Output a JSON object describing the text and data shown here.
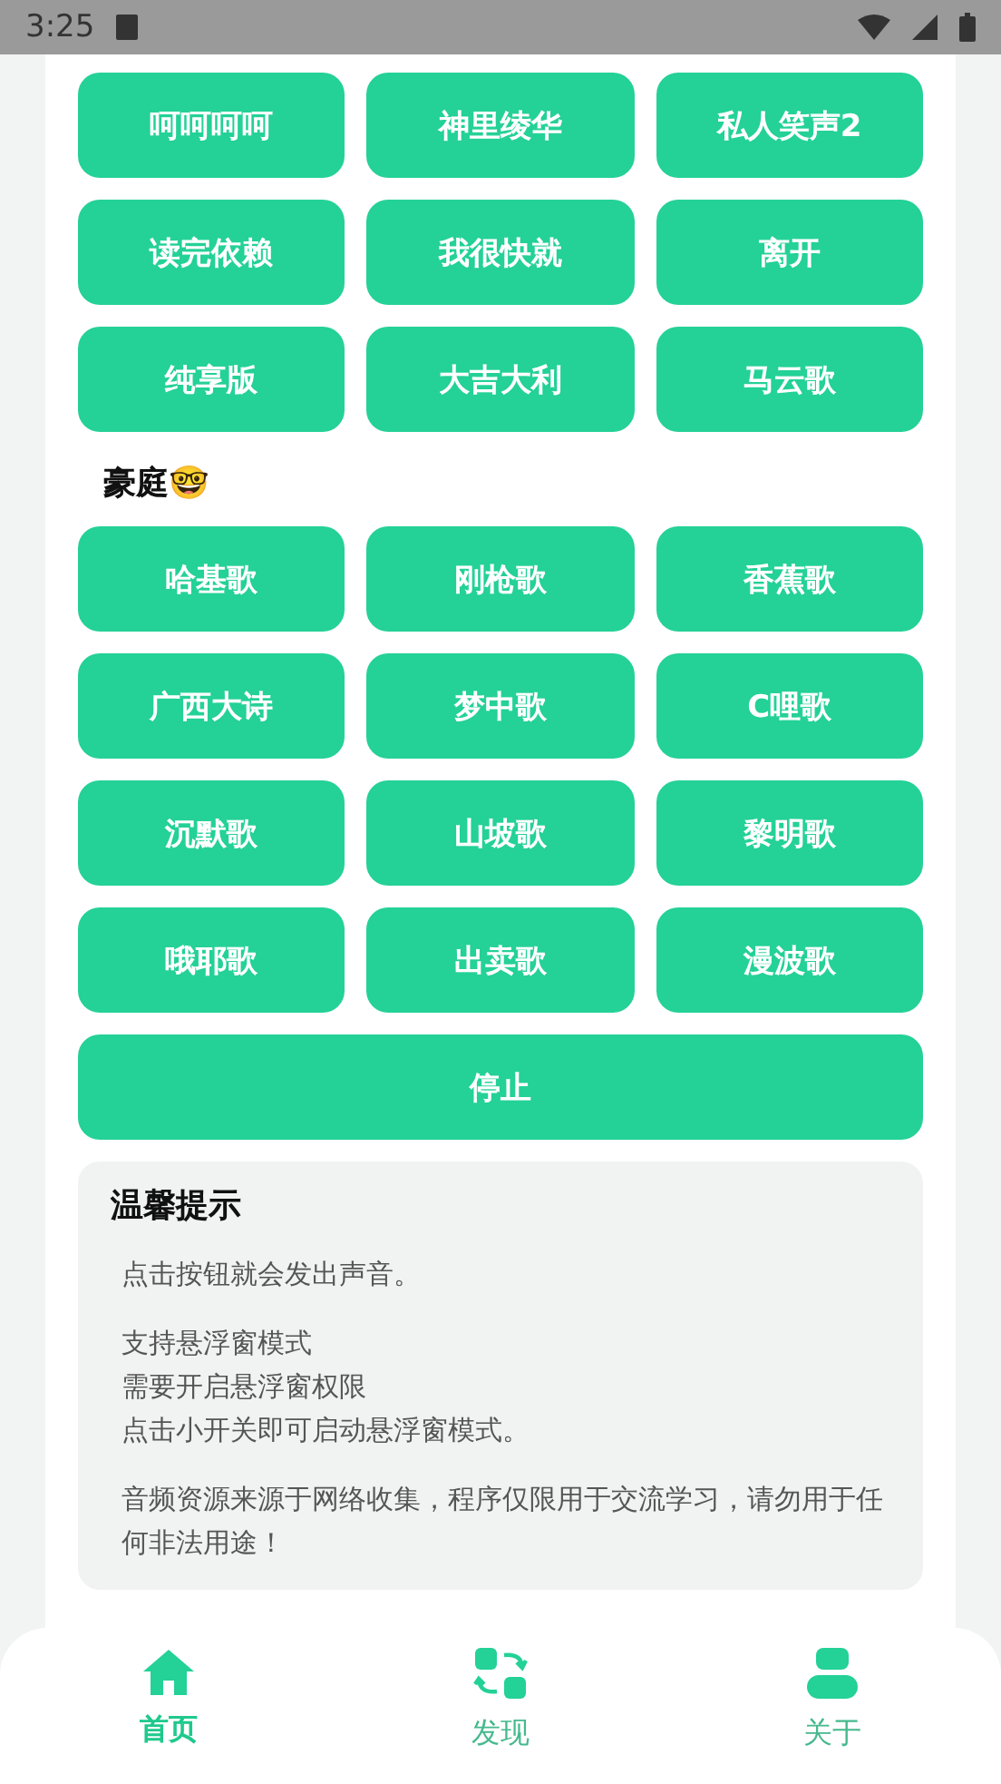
{
  "status_bar": {
    "time": "3:25"
  },
  "groups": [
    {
      "buttons": [
        "呵呵呵呵",
        "神里绫华",
        "私人笑声2",
        "读完依赖",
        "我很快就",
        "离开",
        "纯享版",
        "大吉大利",
        "马云歌"
      ]
    },
    {
      "title": "豪庭🤓",
      "buttons": [
        "哈基歌",
        "刚枪歌",
        "香蕉歌",
        "广西大诗",
        "梦中歌",
        "C哩歌",
        "沉默歌",
        "山坡歌",
        "黎明歌",
        "哦耶歌",
        "出卖歌",
        "漫波歌"
      ]
    }
  ],
  "stop_button": "停止",
  "tips": {
    "title": "温馨提示",
    "paragraphs": [
      [
        "点击按钮就会发出声音。"
      ],
      [
        "支持悬浮窗模式",
        "需要开启悬浮窗权限",
        "点击小开关即可启动悬浮窗模式。"
      ],
      [
        "音频资源来源于网络收集，程序仅限用于交流学习，请勿用于任何非法用途！"
      ]
    ]
  },
  "nav": [
    {
      "label": "首页",
      "selected": true
    },
    {
      "label": "发现",
      "selected": false
    },
    {
      "label": "关于",
      "selected": false
    }
  ]
}
